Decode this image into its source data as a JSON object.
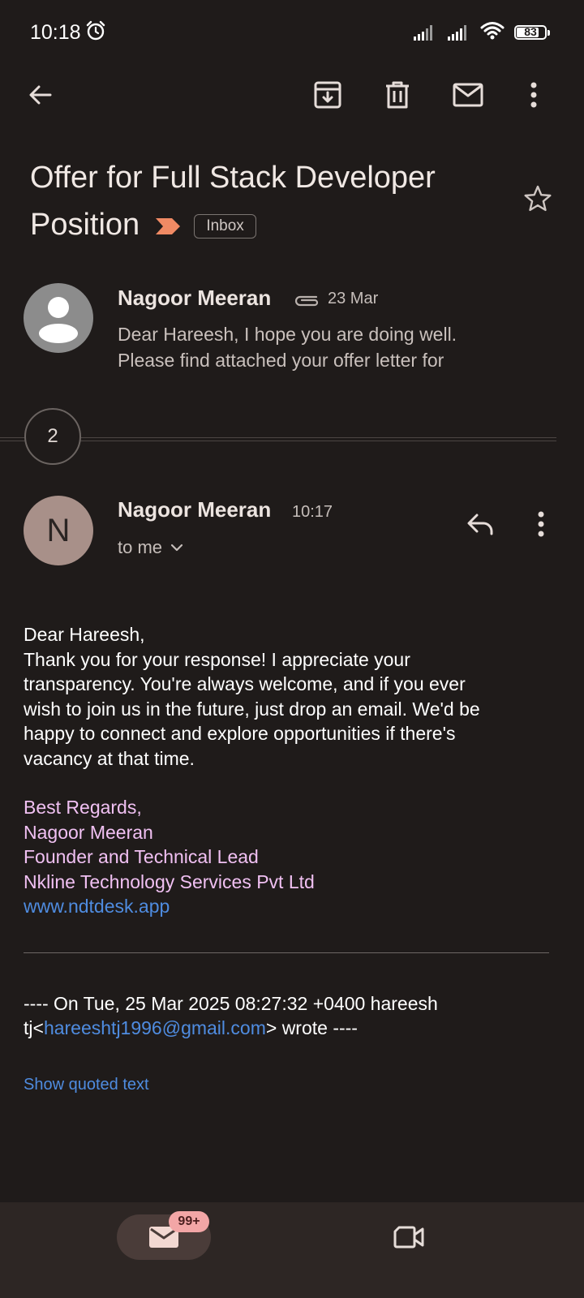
{
  "status_bar": {
    "time": "10:18",
    "battery": "83",
    "battery_level": 0.83
  },
  "toolbar": {
    "back_icon": "arrow-left-icon",
    "archive_icon": "archive-icon",
    "delete_icon": "trash-icon",
    "unread_icon": "mail-icon",
    "more_icon": "more-vertical-icon"
  },
  "subject": {
    "text": "Offer for Full Stack Developer Position",
    "label": "Inbox"
  },
  "collapsed_message": {
    "sender": "Nagoor Meeran",
    "date": "23 Mar",
    "snippet_line1": "Dear Hareesh, I hope you are doing well.",
    "snippet_line2": "Please find attached your offer letter for"
  },
  "thread": {
    "hidden_count": "2"
  },
  "message": {
    "avatar_letter": "N",
    "sender": "Nagoor Meeran",
    "time": "10:17",
    "recipient": "to me",
    "body": {
      "greeting": "Dear Hareesh,",
      "line1": "Thank you for your response! I appreciate your",
      "line2": "transparency. You're always welcome, and if you ever",
      "line3": "wish to join us in the future, just drop an email. We'd be",
      "line4": "happy to connect and explore opportunities if there's",
      "line5": "vacancy at that time."
    },
    "signature": {
      "closing": "Best Regards,",
      "name": "Nagoor Meeran",
      "title": "Founder and Technical Lead",
      "company": "Nkline Technology Services Pvt Ltd",
      "website": "www.ndtdesk.app"
    },
    "quote": {
      "line1": "---- On Tue, 25 Mar 2025 08:27:32 +0400 hareesh",
      "prefix": "tj<",
      "email": "hareeshtj1996@gmail.com",
      "suffix": "> wrote ----"
    },
    "show_quoted": "Show quoted text"
  },
  "bottom_nav": {
    "mail_badge": "99+"
  },
  "colors": {
    "background": "#1f1b1a",
    "link": "#4f8ce0",
    "signature": "#f0c0f2",
    "badge": "#f2a6a6"
  }
}
